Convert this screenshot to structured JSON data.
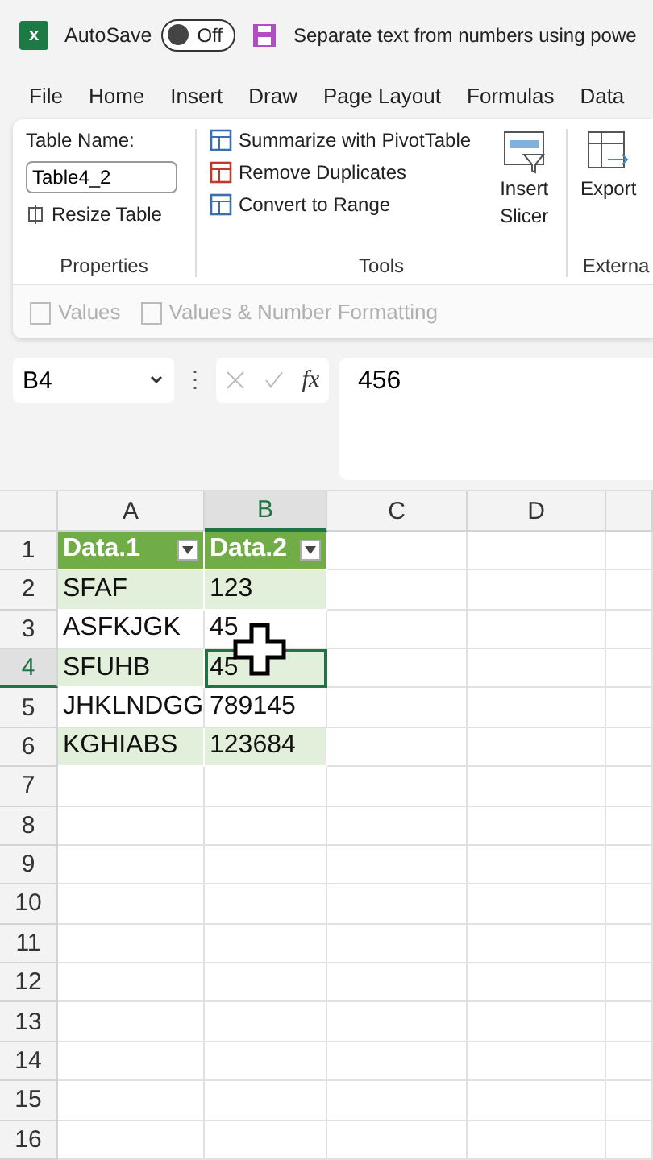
{
  "title_bar": {
    "app_icon": "x",
    "autosave_label": "AutoSave",
    "autosave": {
      "on": false,
      "label": "Off"
    },
    "document_title": "Separate text from numbers using powe"
  },
  "menu": [
    "File",
    "Home",
    "Insert",
    "Draw",
    "Page Layout",
    "Formulas",
    "Data"
  ],
  "ribbon": {
    "properties": {
      "table_name_label": "Table Name:",
      "table_name": "Table4_2",
      "resize": "Resize Table",
      "group": "Properties"
    },
    "tools": {
      "items": [
        {
          "kind": "pivot",
          "label": "Summarize with PivotTable"
        },
        {
          "kind": "dupes",
          "label": "Remove Duplicates"
        },
        {
          "kind": "range",
          "label": "Convert to Range"
        }
      ],
      "slicer": [
        "Insert",
        "Slicer"
      ],
      "group": "Tools"
    },
    "external": {
      "export": "Export",
      "group": "Externa"
    }
  },
  "paste_bar": [
    {
      "label": "Values",
      "disabled": true
    },
    {
      "label": "Values & Number Formatting",
      "disabled": true
    }
  ],
  "formula_bar": {
    "name_box": "B4",
    "more": "⋮",
    "fx": "fx",
    "value": "456"
  },
  "sheet": {
    "columns": [
      {
        "label": "A",
        "selected": false
      },
      {
        "label": "B",
        "selected": true
      },
      {
        "label": "C",
        "selected": false
      },
      {
        "label": "D",
        "selected": false
      }
    ],
    "rows": [
      {
        "number": "1",
        "selected": false,
        "cells": [
          {
            "text": "Data.1",
            "active": false
          },
          {
            "text": "Data.2",
            "active": false
          }
        ]
      },
      {
        "number": "2",
        "selected": false,
        "cells": [
          {
            "text": "SFAF",
            "active": false
          },
          {
            "text": "123",
            "active": false
          }
        ]
      },
      {
        "number": "3",
        "selected": false,
        "cells": [
          {
            "text": "ASFKJGK",
            "active": false
          },
          {
            "text": "45",
            "active": false
          }
        ]
      },
      {
        "number": "4",
        "selected": true,
        "cells": [
          {
            "text": "SFUHB",
            "active": false
          },
          {
            "text": "45",
            "active": true
          }
        ]
      },
      {
        "number": "5",
        "selected": false,
        "cells": [
          {
            "text": "JHKLNDGG",
            "active": false
          },
          {
            "text": "789145",
            "active": false
          }
        ]
      },
      {
        "number": "6",
        "selected": false,
        "cells": [
          {
            "text": "KGHIABS",
            "active": false
          },
          {
            "text": "123684",
            "active": false
          }
        ]
      },
      {
        "number": "7",
        "selected": false,
        "cells": []
      },
      {
        "number": "8",
        "selected": false,
        "cells": []
      },
      {
        "number": "9",
        "selected": false,
        "cells": []
      },
      {
        "number": "10",
        "selected": false,
        "cells": []
      },
      {
        "number": "11",
        "selected": false,
        "cells": []
      },
      {
        "number": "12",
        "selected": false,
        "cells": []
      },
      {
        "number": "13",
        "selected": false,
        "cells": []
      },
      {
        "number": "14",
        "selected": false,
        "cells": []
      },
      {
        "number": "15",
        "selected": false,
        "cells": []
      },
      {
        "number": "16",
        "selected": false,
        "cells": []
      }
    ]
  }
}
